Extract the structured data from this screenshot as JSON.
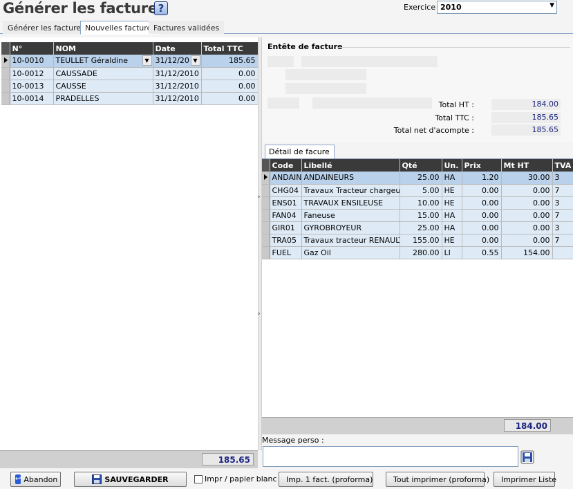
{
  "header": {
    "title": "Générer les factures",
    "help": "?"
  },
  "exercice": {
    "label": "Exercice",
    "value": "2010"
  },
  "tabs": [
    {
      "label": "Générer les factures",
      "active": false
    },
    {
      "label": "Nouvelles factures",
      "active": true
    },
    {
      "label": "Factures validées",
      "active": false
    }
  ],
  "invoices": {
    "columns": [
      "N°",
      "NOM",
      "Date",
      "Total TTC"
    ],
    "rows": [
      {
        "num": "10-0010",
        "nom": "TEULLET Géraldine",
        "date": "31/12/20",
        "total": "185.65",
        "selected": true
      },
      {
        "num": "10-0012",
        "nom": "CAUSSADE",
        "date": "31/12/2010",
        "total": "0.00"
      },
      {
        "num": "10-0013",
        "nom": "CAUSSE",
        "date": "31/12/2010",
        "total": "0.00"
      },
      {
        "num": "10-0014",
        "nom": "PRADELLES",
        "date": "31/12/2010",
        "total": "0.00"
      }
    ],
    "footer_total": "185.65"
  },
  "entete": {
    "title": "Entête de facture",
    "total_ht_label": "Total HT :",
    "total_ht": "184.00",
    "total_ttc_label": "Total TTC :",
    "total_ttc": "185.65",
    "total_net_label": "Total net d'acompte :",
    "total_net": "185.65"
  },
  "detail": {
    "tab_label": "Détail de facure",
    "columns": [
      "Code",
      "Libellé",
      "Qté",
      "Un.",
      "Prix",
      "Mt HT",
      "TVA"
    ],
    "rows": [
      {
        "code": "ANDAIN",
        "libelle": "ANDAINEURS",
        "qte": "25.00",
        "un": "HA",
        "prix": "1.20",
        "mt": "30.00",
        "tva": "3",
        "selected": true
      },
      {
        "code": "CHG04",
        "libelle": "Travaux Tracteur chargeur",
        "qte": "5.00",
        "un": "HE",
        "prix": "0.00",
        "mt": "0.00",
        "tva": "7"
      },
      {
        "code": "ENS01",
        "libelle": "TRAVAUX ENSILEUSE",
        "qte": "10.00",
        "un": "HE",
        "prix": "0.00",
        "mt": "0.00",
        "tva": "3"
      },
      {
        "code": "FAN04",
        "libelle": "Faneuse",
        "qte": "15.00",
        "un": "HA",
        "prix": "0.00",
        "mt": "0.00",
        "tva": "7"
      },
      {
        "code": "GIR01",
        "libelle": "GYROBROYEUR",
        "qte": "25.00",
        "un": "HA",
        "prix": "0.00",
        "mt": "0.00",
        "tva": "3"
      },
      {
        "code": "TRA05",
        "libelle": "Travaux tracteur RENAULT",
        "qte": "155.00",
        "un": "HE",
        "prix": "0.00",
        "mt": "0.00",
        "tva": "7"
      },
      {
        "code": "FUEL",
        "libelle": "Gaz Oil",
        "qte": "280.00",
        "un": "LI",
        "prix": "0.55",
        "mt": "154.00",
        "tva": ""
      }
    ],
    "footer_total": "184.00"
  },
  "message": {
    "label": "Message perso :",
    "value": ""
  },
  "buttons": {
    "abandon": "Abandon",
    "save": "SAUVEGARDER",
    "blank_paper": "Impr / papier blanc",
    "print_one": "Imp. 1 fact. (proforma)",
    "print_all": "Tout imprimer (proforma)",
    "print_list": "Imprimer Liste"
  }
}
